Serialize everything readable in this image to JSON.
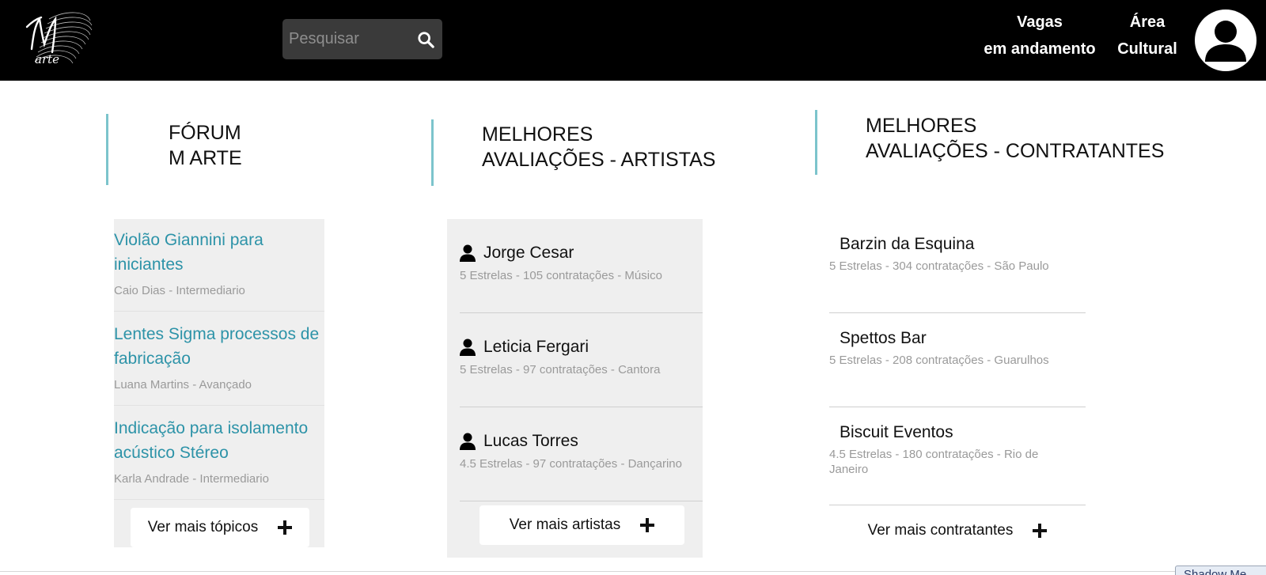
{
  "header": {
    "logo_text": "M arte",
    "search": {
      "placeholder": "Pesquisar",
      "value": ""
    },
    "nav": [
      {
        "line1": "Vagas",
        "line2": "em andamento"
      },
      {
        "line1": "Área",
        "line2": "Cultural"
      }
    ]
  },
  "forum": {
    "title_line1": "FÓRUM",
    "title_line2": "M ARTE",
    "topics": [
      {
        "title": "Violão Giannini para iniciantes",
        "meta": "Caio Dias - Intermediario"
      },
      {
        "title": "Lentes Sigma processos de fabricação",
        "meta": "Luana Martins - Avançado"
      },
      {
        "title": "Indicação para isolamento acústico Stéreo",
        "meta": "Karla Andrade - Intermediario"
      }
    ],
    "more_label": "Ver mais tópicos"
  },
  "artists": {
    "title_line1": "MELHORES",
    "title_line2": "AVALIAÇÕES - ARTISTAS",
    "items": [
      {
        "name": "Jorge Cesar",
        "meta": "5 Estrelas - 105 contratações - Músico"
      },
      {
        "name": "Leticia Fergari",
        "meta": "5 Estrelas - 97 contratações - Cantora"
      },
      {
        "name": "Lucas Torres",
        "meta": "4.5 Estrelas - 97 contratações - Dançarino"
      }
    ],
    "more_label": "Ver mais artistas"
  },
  "hirers": {
    "title_line1": "MELHORES",
    "title_line2": "AVALIAÇÕES - CONTRATANTES",
    "items": [
      {
        "name": "Barzin da Esquina",
        "meta": "5 Estrelas - 304 contratações - São Paulo"
      },
      {
        "name": "Spettos Bar",
        "meta": "5 Estrelas - 208 contratações - Guarulhos"
      },
      {
        "name": "Biscuit Eventos",
        "meta": "4.5 Estrelas - 180 contratações - Rio de Janeiro"
      }
    ],
    "more_label": "Ver mais contratantes"
  },
  "footer_tab": "Shadow Me",
  "colors": {
    "header_bg": "#000000",
    "accent_teal": "#2d93a8",
    "section_bar": "#7cc4cc",
    "panel_bg": "#efefef",
    "muted_text": "#9a9a9a"
  },
  "icons": [
    "search-icon",
    "avatar-icon",
    "person-icon",
    "plus-icon"
  ]
}
